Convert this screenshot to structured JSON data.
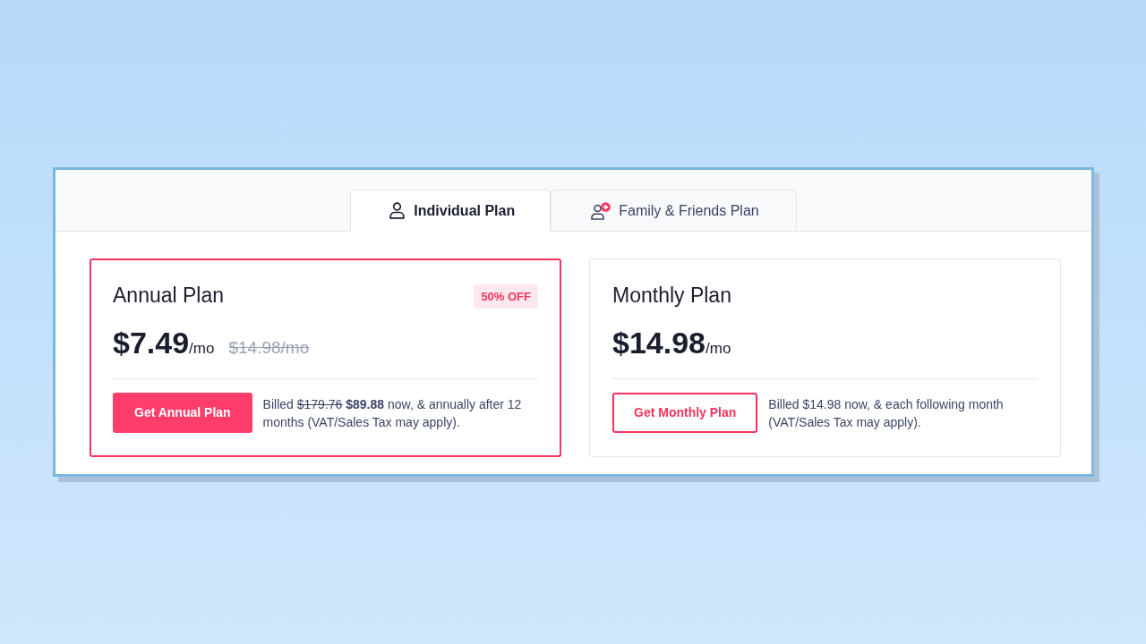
{
  "tabs": [
    {
      "label": "Individual Plan",
      "selected": true
    },
    {
      "label": "Family & Friends Plan",
      "selected": false
    }
  ],
  "plans": [
    {
      "title": "Annual Plan",
      "selected": true,
      "badge": "50% OFF",
      "price": "$7.49",
      "unit": "/mo",
      "old_price": "$14.98/mo",
      "button": "Get Annual Plan",
      "note": [
        {
          "kind": "plain",
          "text": "Billed "
        },
        {
          "kind": "struck",
          "text": "$179.76"
        },
        {
          "kind": "bold",
          "text": " $89.88"
        },
        {
          "kind": "plain",
          "text": " now, & annually after 12 months (VAT/Sales Tax may apply)."
        }
      ]
    },
    {
      "title": "Monthly Plan",
      "selected": false,
      "price": "$14.98",
      "unit": "/mo",
      "button": "Get Monthly Plan",
      "note": [
        {
          "kind": "plain",
          "text": "Billed $14.98 now, & each following month (VAT/Sales Tax may apply)."
        }
      ]
    }
  ]
}
